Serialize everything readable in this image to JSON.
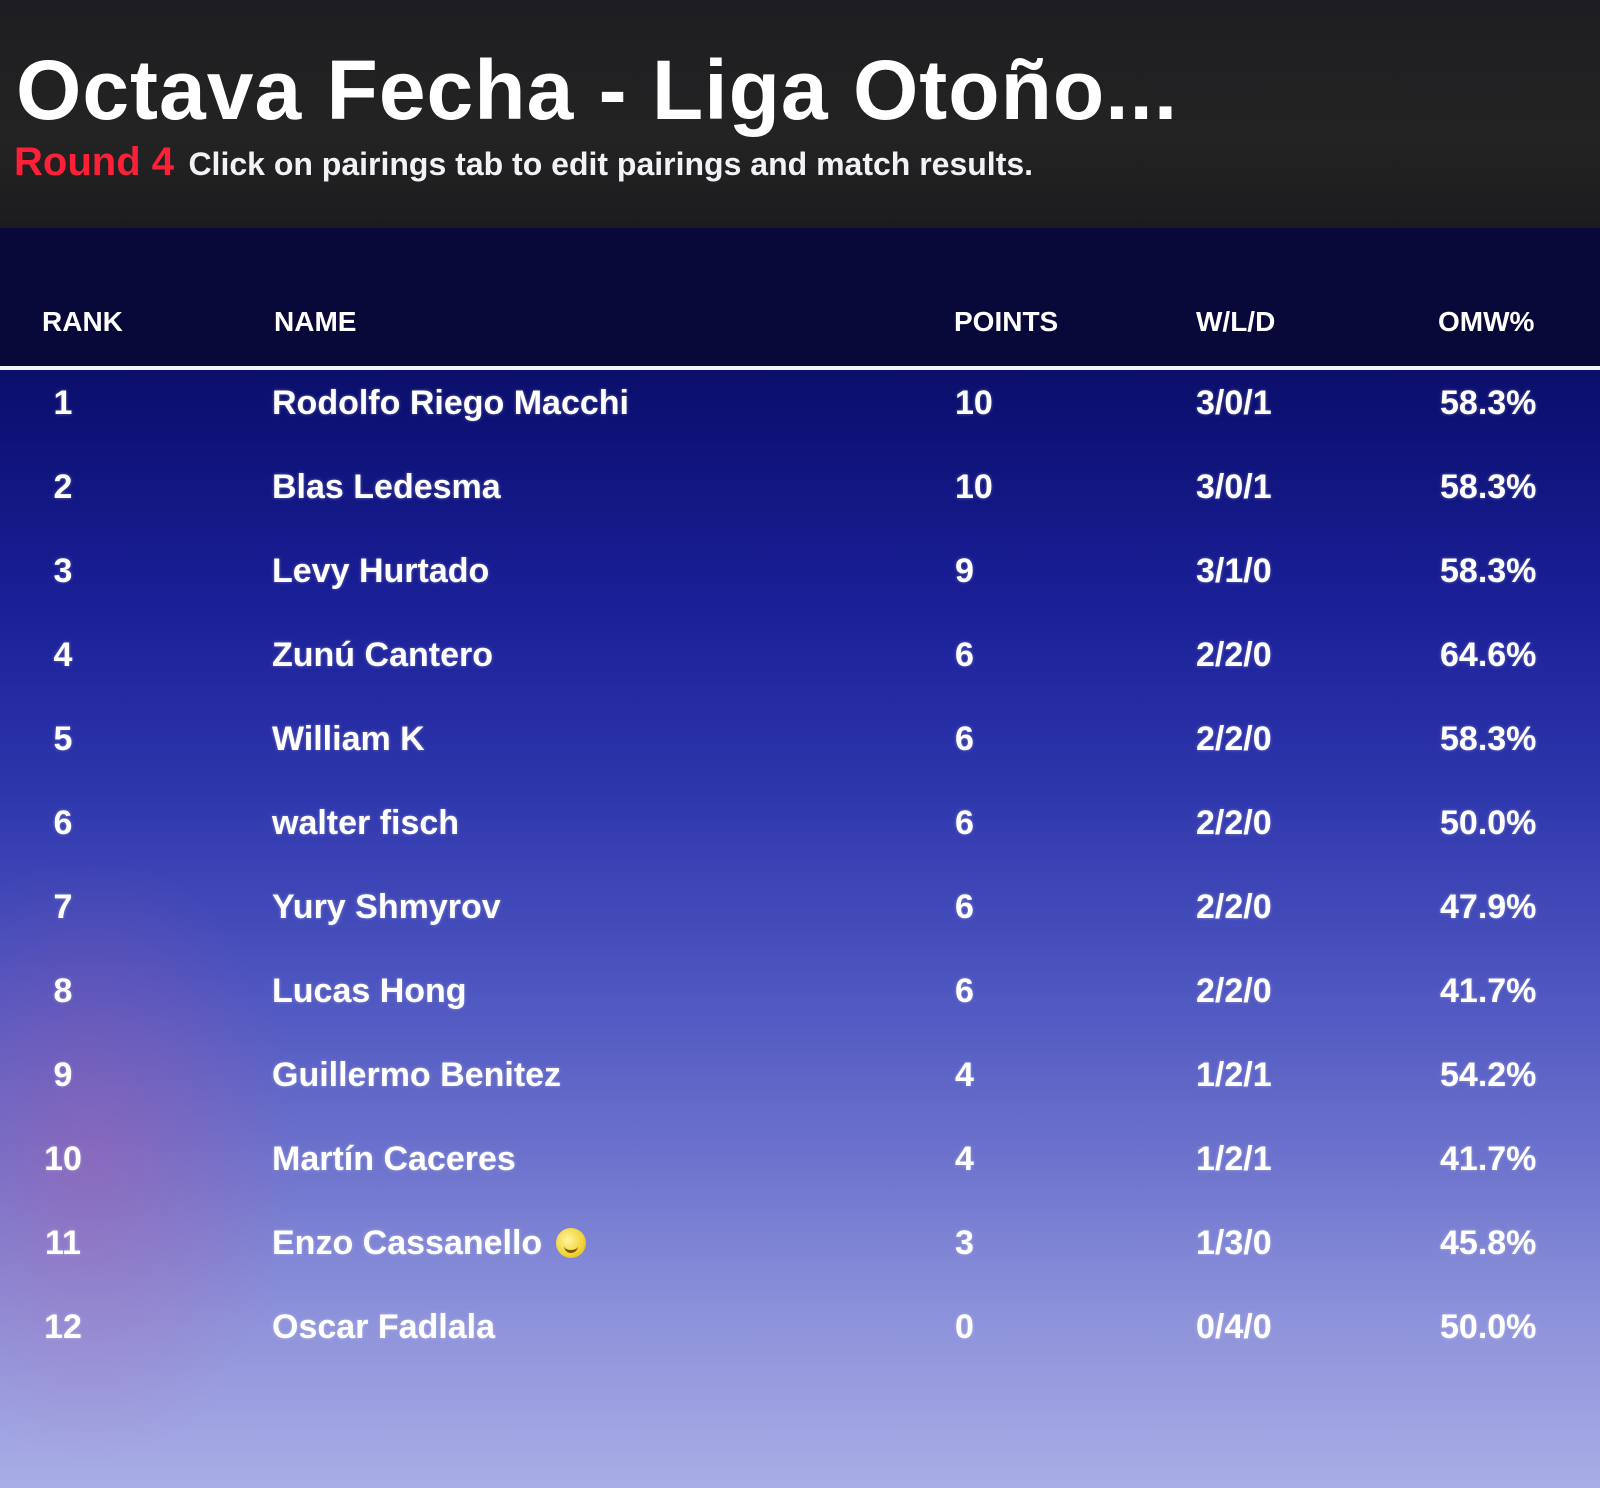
{
  "header": {
    "title": "Octava Fecha - Liga Otoño...",
    "round_label": "Round 4",
    "hint": "Click on pairings tab to edit pairings and match results."
  },
  "table": {
    "columns": {
      "rank": "RANK",
      "name": "NAME",
      "points": "POINTS",
      "wld": "W/L/D",
      "omw": "OMW%"
    },
    "rows": [
      {
        "rank": "1",
        "name": "Rodolfo Riego Macchi",
        "points": "10",
        "wld": "3/0/1",
        "omw": "58.3%"
      },
      {
        "rank": "2",
        "name": "Blas Ledesma",
        "points": "10",
        "wld": "3/0/1",
        "omw": "58.3%"
      },
      {
        "rank": "3",
        "name": "Levy Hurtado",
        "points": "9",
        "wld": "3/1/0",
        "omw": "58.3%"
      },
      {
        "rank": "4",
        "name": "Zunú Cantero",
        "points": "6",
        "wld": "2/2/0",
        "omw": "64.6%"
      },
      {
        "rank": "5",
        "name": "William K",
        "points": "6",
        "wld": "2/2/0",
        "omw": "58.3%"
      },
      {
        "rank": "6",
        "name": "walter fisch",
        "points": "6",
        "wld": "2/2/0",
        "omw": "50.0%"
      },
      {
        "rank": "7",
        "name": "Yury Shmyrov",
        "points": "6",
        "wld": "2/2/0",
        "omw": "47.9%"
      },
      {
        "rank": "8",
        "name": "Lucas Hong",
        "points": "6",
        "wld": "2/2/0",
        "omw": "41.7%"
      },
      {
        "rank": "9",
        "name": "Guillermo Benitez",
        "points": "4",
        "wld": "1/2/1",
        "omw": "54.2%"
      },
      {
        "rank": "10",
        "name": "Martín Caceres",
        "points": "4",
        "wld": "1/2/1",
        "omw": "41.7%"
      },
      {
        "rank": "11",
        "name": "Enzo Cassanello",
        "points": "3",
        "wld": "1/3/0",
        "omw": "45.8%",
        "icon": "smiley-emoji-icon"
      },
      {
        "rank": "12",
        "name": "Oscar Fadlala",
        "points": "0",
        "wld": "0/4/0",
        "omw": "50.0%"
      }
    ]
  },
  "colors": {
    "round_label": "#ff2038",
    "header_bg": "#222222",
    "table_head_bg": "#080939",
    "panel_top": "#080a48",
    "panel_bottom": "#a9ade6"
  }
}
